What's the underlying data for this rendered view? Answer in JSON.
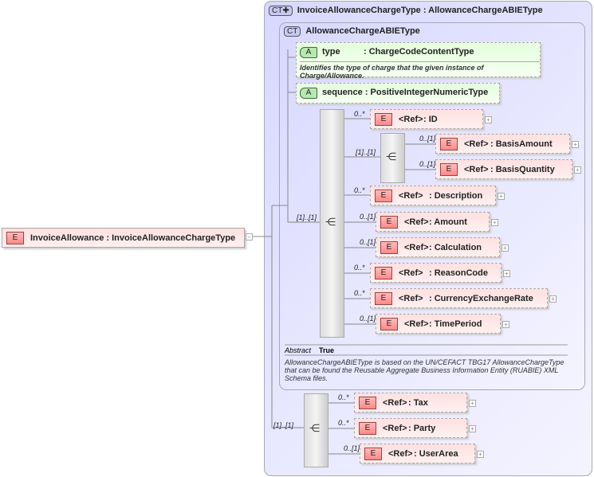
{
  "root": {
    "badge": "E",
    "name": "InvoiceAllowance",
    "type": ": InvoiceAllowanceChargeType",
    "toggle": "−"
  },
  "outer": {
    "badge": "CT✚",
    "title": "InvoiceAllowanceChargeType : AllowanceChargeABIEType"
  },
  "inner": {
    "badge": "CT",
    "title": "AllowanceChargeABIEType",
    "attributes": [
      {
        "badge": "A",
        "name": "type",
        "type": ": ChargeCodeContentType",
        "doc": "Identifies the type of charge that the given instance of Charge/Allowance."
      },
      {
        "badge": "A",
        "name": "sequence",
        "type": ": PositiveIntegerNumericType"
      }
    ],
    "sequence_card": "[1]..[1]",
    "elements": [
      {
        "card": "0..*",
        "ref": "<Ref>",
        "type": ": ID"
      },
      {
        "card": "0..*",
        "ref": "<Ref>",
        "type": ": Description"
      },
      {
        "card": "0..[1]",
        "ref": "<Ref>",
        "type": ": Amount"
      },
      {
        "card": "0..[1]",
        "ref": "<Ref>",
        "type": ": Calculation"
      },
      {
        "card": "0..*",
        "ref": "<Ref>",
        "type": ": ReasonCode"
      },
      {
        "card": "0..*",
        "ref": "<Ref>",
        "type": ": CurrencyExchangeRate"
      },
      {
        "card": "0..[1]",
        "ref": "<Ref>",
        "type": ": TimePeriod"
      }
    ],
    "sub_sequence_card": "[1]..[1]",
    "sub_elements": [
      {
        "card": "0..[1]",
        "ref": "<Ref>",
        "type": ": BasisAmount"
      },
      {
        "card": "0..[1]",
        "ref": "<Ref>",
        "type": ": BasisQuantity"
      }
    ],
    "abstract_label": "Abstract",
    "abstract_value": "True",
    "doc": "AllowanceChargeABIEType is based on the UN/CEFACT TBG17 AllowanceChargeType that can be found the Reusable Aggregate Business Information Entity (RUABIE) XML Schema files."
  },
  "bottom": {
    "sequence_card": "[1]..[1]",
    "elements": [
      {
        "card": "0..*",
        "ref": "<Ref>",
        "type": ": Tax"
      },
      {
        "card": "0..*",
        "ref": "<Ref>",
        "type": ": Party"
      },
      {
        "card": "0..[1]",
        "ref": "<Ref>",
        "type": ": UserArea"
      }
    ]
  },
  "badge_label": "E",
  "plus": "+"
}
